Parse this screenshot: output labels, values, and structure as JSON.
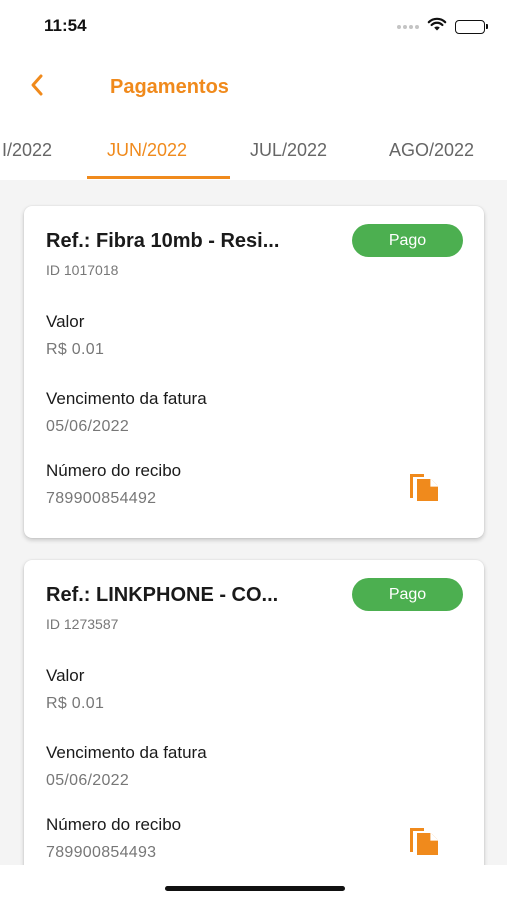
{
  "status_bar": {
    "time": "11:54",
    "icons": [
      "signal-dots-icon",
      "wifi-icon",
      "battery-icon"
    ]
  },
  "header": {
    "back_icon": "chevron-left-icon",
    "title": "Pagamentos"
  },
  "tabs": [
    {
      "label": "I/2022",
      "active": false
    },
    {
      "label": "JUN/2022",
      "active": true
    },
    {
      "label": "JUL/2022",
      "active": false
    },
    {
      "label": "AGO/2022",
      "active": false
    }
  ],
  "colors": {
    "accent": "#f08a1c",
    "status_paid": "#4caf50",
    "background": "#f4f4f4"
  },
  "payments": [
    {
      "title": "Ref.: Fibra 10mb - Resi...",
      "id": "ID 1017018",
      "status": "Pago",
      "valor_label": "Valor",
      "valor": "R$ 0.01",
      "vencimento_label": "Vencimento da fatura",
      "vencimento": "05/06/2022",
      "recibo_label": "Número do recibo",
      "recibo": "789900854492",
      "copy_icon": "copy-icon"
    },
    {
      "title": "Ref.: LINKPHONE - CO...",
      "id": "ID 1273587",
      "status": "Pago",
      "valor_label": "Valor",
      "valor": "R$ 0.01",
      "vencimento_label": "Vencimento da fatura",
      "vencimento": "05/06/2022",
      "recibo_label": "Número do recibo",
      "recibo": "789900854493",
      "copy_icon": "copy-icon"
    }
  ]
}
